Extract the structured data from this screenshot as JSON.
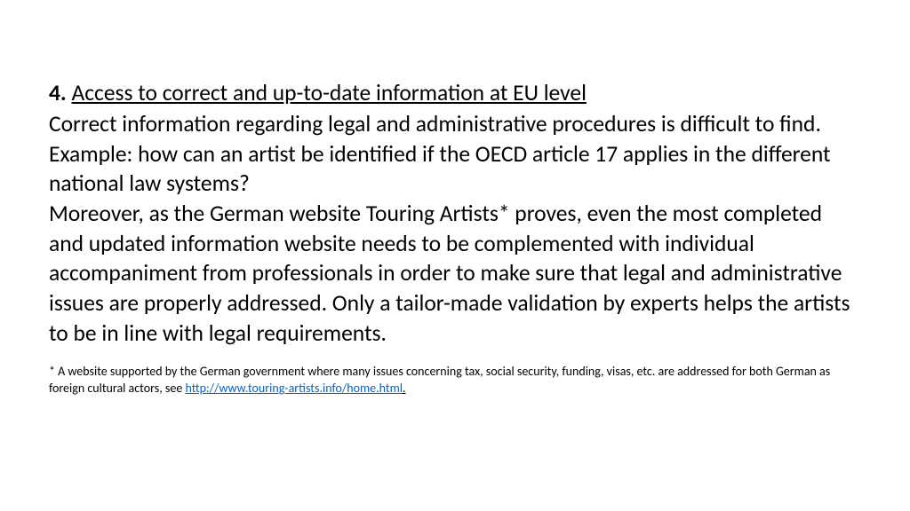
{
  "heading": {
    "number": "4.",
    "title": "Access to correct and up-to-date information at EU level"
  },
  "body": {
    "paragraph1": "Correct information regarding legal and administrative procedures is difficult to find. Example: how can an artist be identified if the OECD article 17 applies in the different national law systems?",
    "paragraph2": "Moreover, as the German website Touring Artists* proves, even the most completed and updated information website needs to be complemented with individual accompaniment from professionals in order to make sure that legal and administrative issues are properly addressed. Only a tailor-made validation by experts helps the artists to be in line with legal requirements."
  },
  "footnote": {
    "text_before": "* A website supported by the German government where many issues concerning tax, social security, funding, visas, etc. are addressed for both German as foreign cultural actors, see ",
    "link_text": "http://www.touring-artists.info/home.html",
    "link_href": "http://www.touring-artists.info/home.html",
    "text_after": "."
  }
}
